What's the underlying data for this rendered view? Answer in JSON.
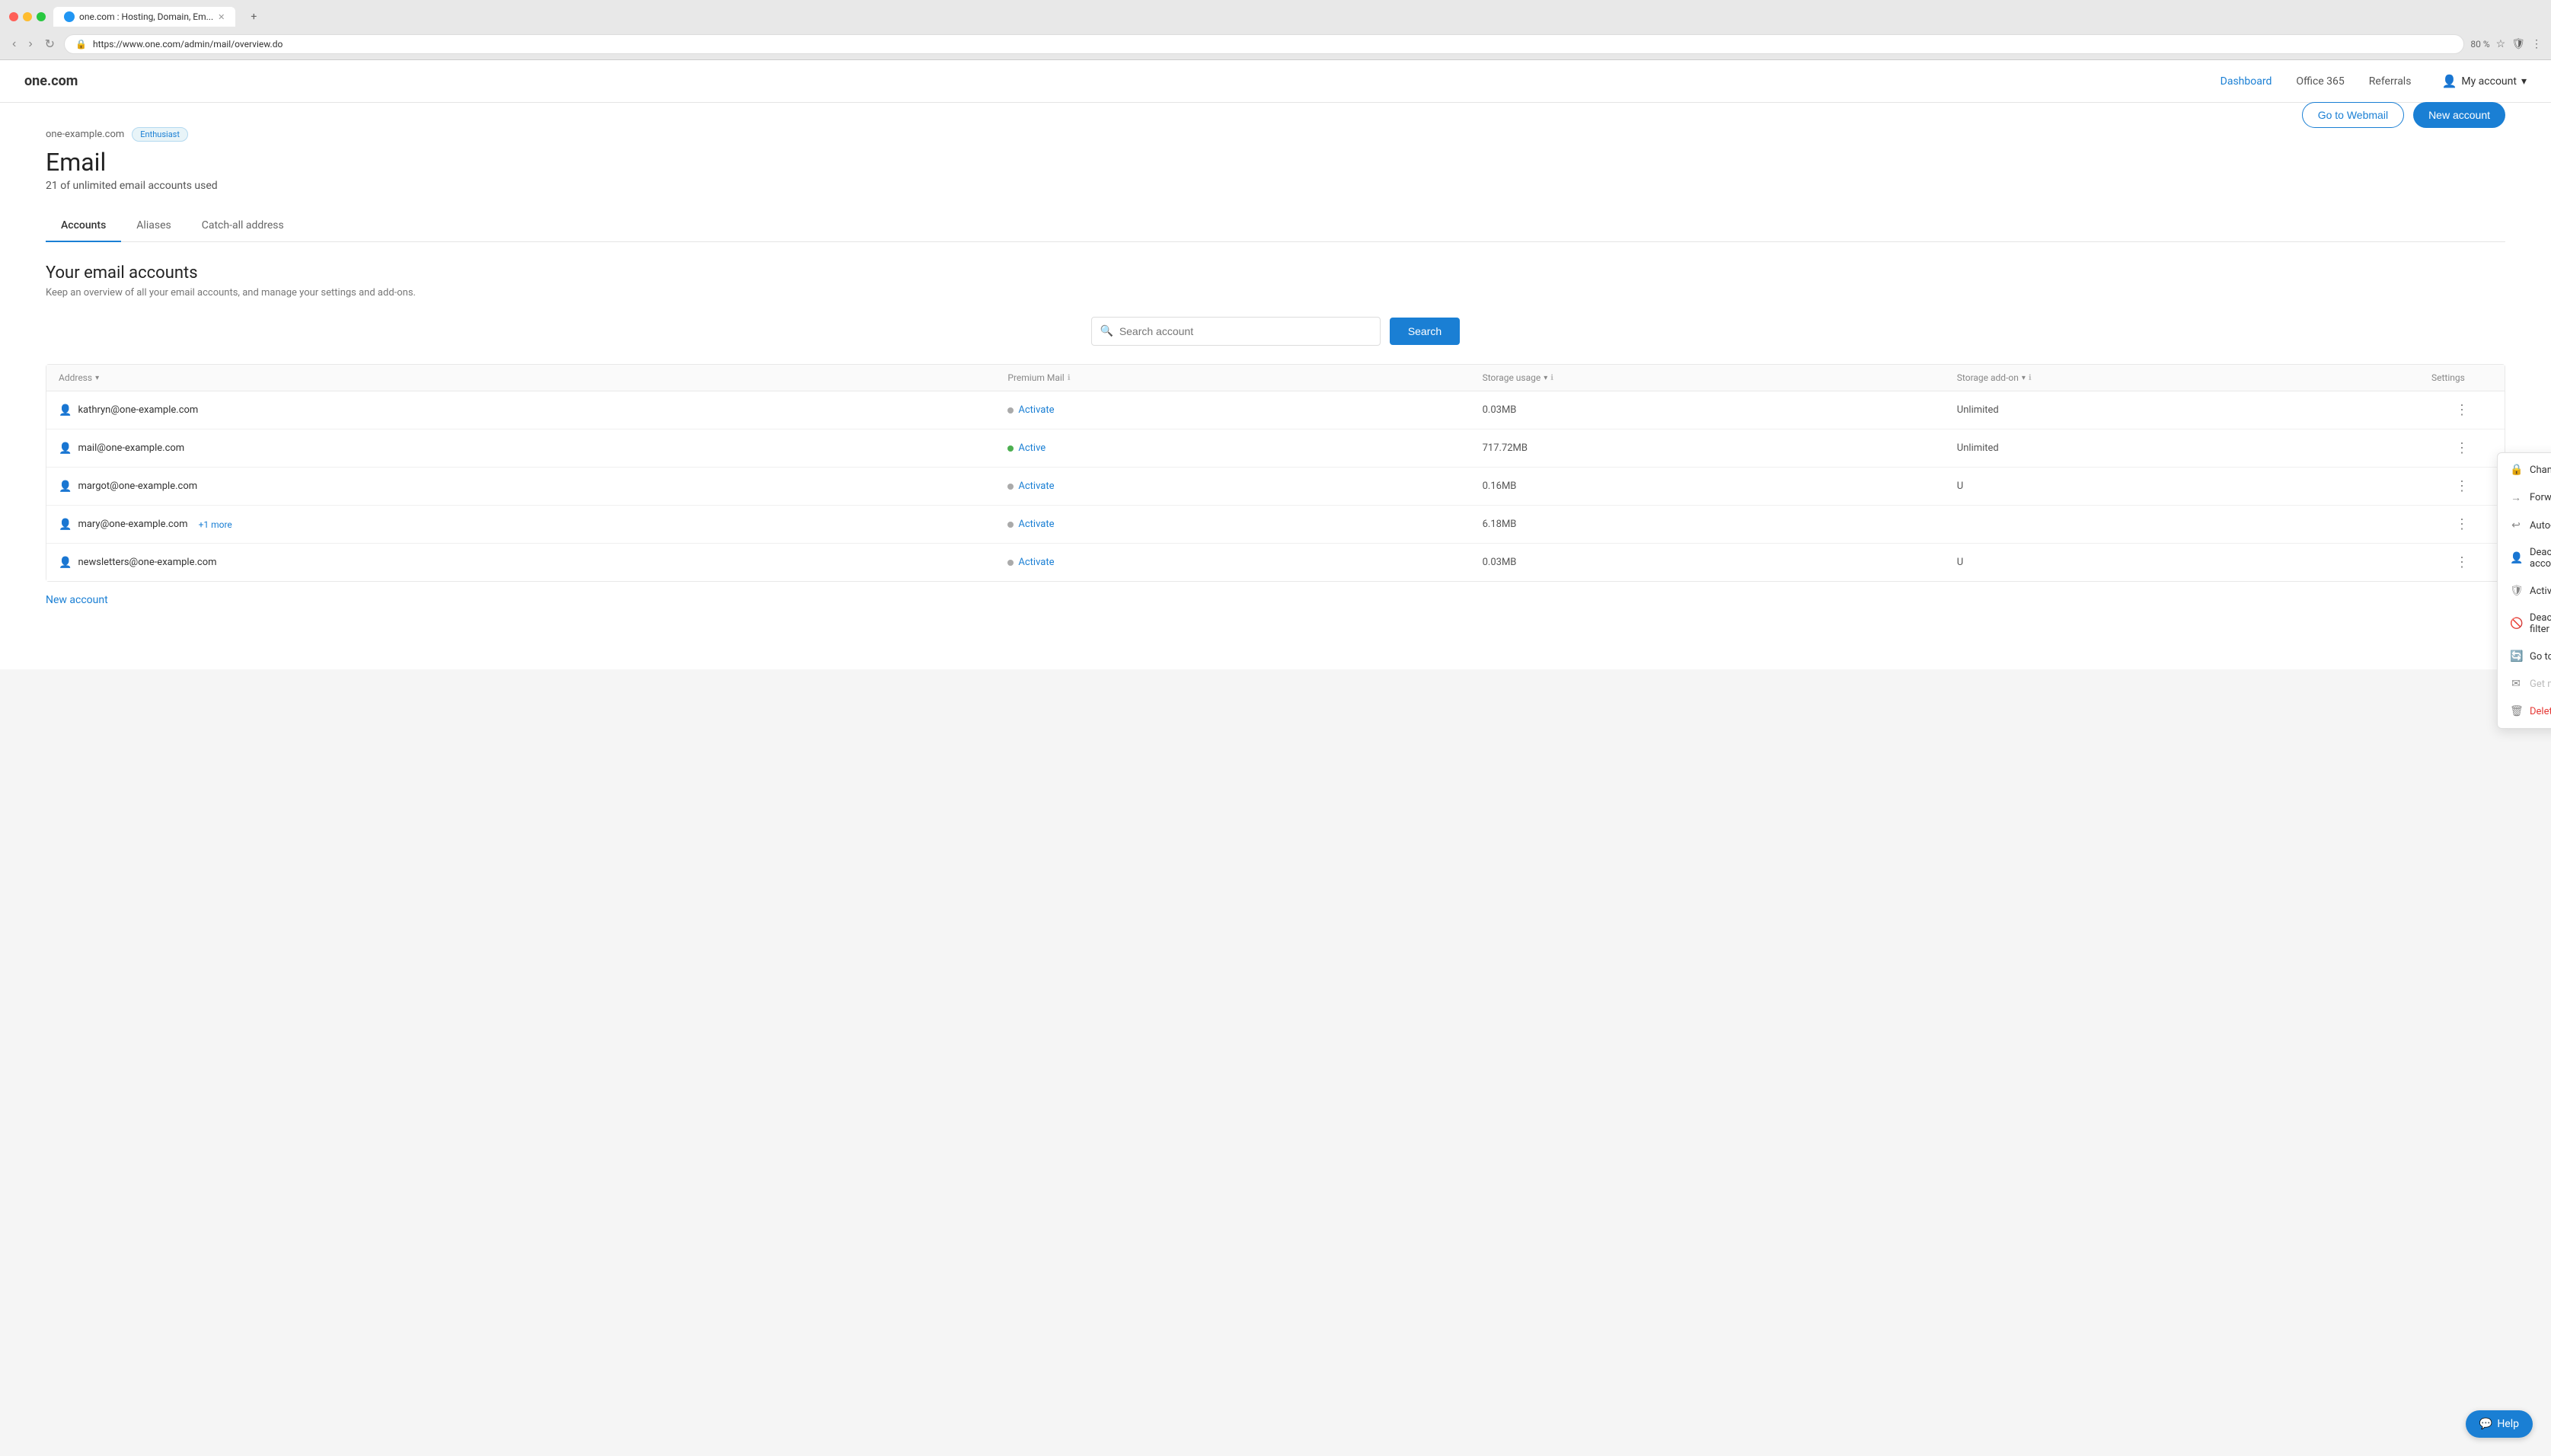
{
  "browser": {
    "tab_title": "one.com : Hosting, Domain, Em...",
    "url": "https://www.one.com/admin/mail/overview.do",
    "zoom": "80 %"
  },
  "nav": {
    "logo": "one.com",
    "links": [
      {
        "label": "Dashboard",
        "active": true
      },
      {
        "label": "Office 365",
        "active": false
      },
      {
        "label": "Referrals",
        "active": false
      }
    ],
    "my_account": "My account"
  },
  "page": {
    "domain": "one-example.com",
    "badge": "Enthusiast",
    "title": "Email",
    "subtitle": "21 of unlimited email accounts used",
    "btn_webmail": "Go to Webmail",
    "btn_new": "New account"
  },
  "tabs": [
    {
      "label": "Accounts",
      "active": true
    },
    {
      "label": "Aliases",
      "active": false
    },
    {
      "label": "Catch-all address",
      "active": false
    }
  ],
  "section": {
    "title": "Your email accounts",
    "desc": "Keep an overview of all your email accounts, and manage your settings and add-ons."
  },
  "search": {
    "placeholder": "Search account",
    "btn_label": "Search"
  },
  "table": {
    "headers": [
      {
        "label": "Address",
        "sortable": true
      },
      {
        "label": "Premium Mail",
        "info": true
      },
      {
        "label": "Storage usage",
        "sortable": true,
        "info": true
      },
      {
        "label": "Storage add-on",
        "sortable": true,
        "info": true
      },
      {
        "label": "Settings"
      }
    ],
    "rows": [
      {
        "email": "kathryn@one-example.com",
        "premium": "Activate",
        "premium_active": false,
        "storage": "0.03MB",
        "addon": "Unlimited",
        "has_menu": false
      },
      {
        "email": "mail@one-example.com",
        "premium": "Active",
        "premium_active": true,
        "storage": "717.72MB",
        "addon": "Unlimited",
        "has_menu": true
      },
      {
        "email": "margot@one-example.com",
        "premium": "Activate",
        "premium_active": false,
        "storage": "0.16MB",
        "addon": "U",
        "has_menu": false
      },
      {
        "email": "mary@one-example.com",
        "extra": "+1 more",
        "premium": "Activate",
        "premium_active": false,
        "storage": "6.18MB",
        "addon": "",
        "has_menu": false
      },
      {
        "email": "newsletters@one-example.com",
        "premium": "Activate",
        "premium_active": false,
        "storage": "0.03MB",
        "addon": "U",
        "has_menu": false
      }
    ]
  },
  "dropdown": {
    "items": [
      {
        "icon": "🔒",
        "label": "Change password",
        "type": "normal"
      },
      {
        "icon": "→",
        "label": "Forwards",
        "type": "normal"
      },
      {
        "icon": "↩",
        "label": "Auto-reply",
        "type": "normal"
      },
      {
        "icon": "👤",
        "label": "Deactivate account",
        "type": "toggle",
        "toggle_on": true
      },
      {
        "icon": "🛡",
        "label": "Activate sanebox",
        "type": "toggle",
        "toggle_on": false
      },
      {
        "icon": "🚫",
        "label": "Deactivate spam filter",
        "type": "toggle",
        "toggle_on": true
      },
      {
        "icon": "🔄",
        "label": "Go to Backup & Restore",
        "type": "normal"
      },
      {
        "icon": "✉",
        "label": "Get more storage",
        "type": "disabled"
      },
      {
        "icon": "🗑",
        "label": "Delete account",
        "type": "danger"
      }
    ]
  },
  "footer": {
    "new_account": "New account",
    "help": "Help"
  }
}
